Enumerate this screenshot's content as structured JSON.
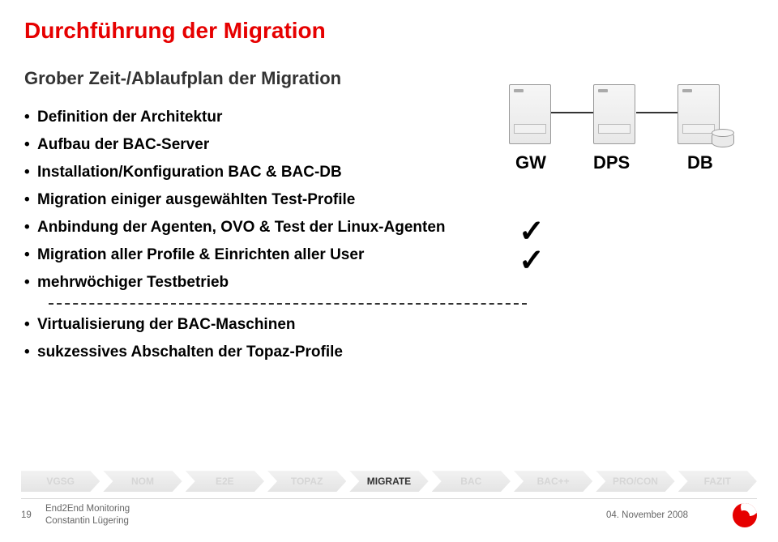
{
  "title": "Durchführung der Migration",
  "subtitle": "Grober Zeit-/Ablaufplan der Migration",
  "bullets": [
    "Definition der Architektur",
    "Aufbau der BAC-Server",
    "Installation/Konfiguration BAC & BAC-DB",
    "Migration einiger ausgewählten Test-Profile",
    "Anbindung der Agenten, OVO & Test der Linux-Agenten",
    "Migration aller Profile & Einrichten aller User",
    "mehrwöchiger Testbetrieb",
    "Virtualisierung der BAC-Maschinen",
    "sukzessives Abschalten der Topaz-Profile"
  ],
  "diagram": {
    "labels": {
      "gw": "GW",
      "dps": "DPS",
      "db": "DB"
    }
  },
  "checkmark": "✓",
  "nav": [
    {
      "label": "VGSG",
      "active": false
    },
    {
      "label": "NOM",
      "active": false
    },
    {
      "label": "E2E",
      "active": false
    },
    {
      "label": "TOPAZ",
      "active": false
    },
    {
      "label": "MIGRATE",
      "active": true
    },
    {
      "label": "BAC",
      "active": false
    },
    {
      "label": "BAC++",
      "active": false
    },
    {
      "label": "PRO/CON",
      "active": false
    },
    {
      "label": "FAZIT",
      "active": false
    }
  ],
  "footer": {
    "page": "19",
    "line1": "End2End Monitoring",
    "line2": "Constantin Lügering",
    "date": "04. November 2008"
  }
}
